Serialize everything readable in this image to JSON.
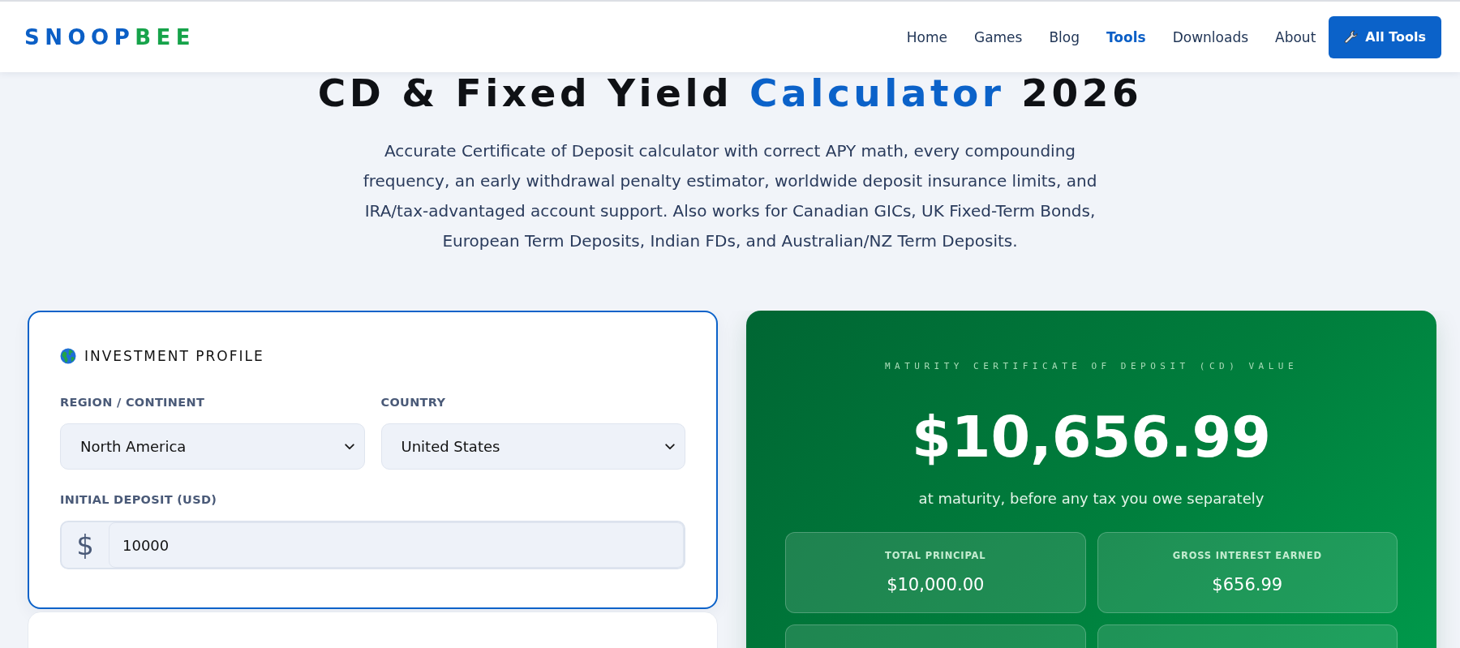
{
  "header": {
    "logo": {
      "primary": "SNOOP",
      "accent": "BEE"
    },
    "nav": [
      {
        "label": "Home",
        "selected": false
      },
      {
        "label": "Games",
        "selected": false
      },
      {
        "label": "Blog",
        "selected": false
      },
      {
        "label": "Tools",
        "selected": true
      },
      {
        "label": "Downloads",
        "selected": false
      },
      {
        "label": "About",
        "selected": false
      }
    ],
    "cta": {
      "label": "All Tools"
    }
  },
  "hero": {
    "title": {
      "before": "CD & Fixed Yield ",
      "highlight": "Calculator",
      "after": " 2026"
    },
    "description": "Accurate Certificate of Deposit calculator with correct APY math, every compounding\nfrequency, an early withdrawal penalty estimator, worldwide deposit insurance limits, and\nIRA/tax-advantaged account support. Also works for Canadian GICs, UK Fixed-Term Bonds,\nEuropean Term Deposits, Indian FDs, and Australian/NZ Term Deposits."
  },
  "profile": {
    "title": "INVESTMENT PROFILE",
    "fields": [
      {
        "kind": "select",
        "label": "REGION / CONTINENT",
        "value": "North America"
      },
      {
        "kind": "select",
        "label": "COUNTRY",
        "value": "United States"
      },
      {
        "kind": "currency",
        "label": "INITIAL DEPOSIT (USD)",
        "prefix": "$",
        "value": "10000"
      }
    ]
  },
  "result": {
    "caption": "MATURITY CERTIFICATE OF DEPOSIT (CD) VALUE",
    "value": "$10,656.99",
    "note": "at maturity, before any tax you owe separately",
    "stats": [
      {
        "label": "TOTAL PRINCIPAL",
        "value": "$10,000.00"
      },
      {
        "label": "GROSS INTEREST EARNED",
        "value": "$656.99"
      }
    ]
  }
}
